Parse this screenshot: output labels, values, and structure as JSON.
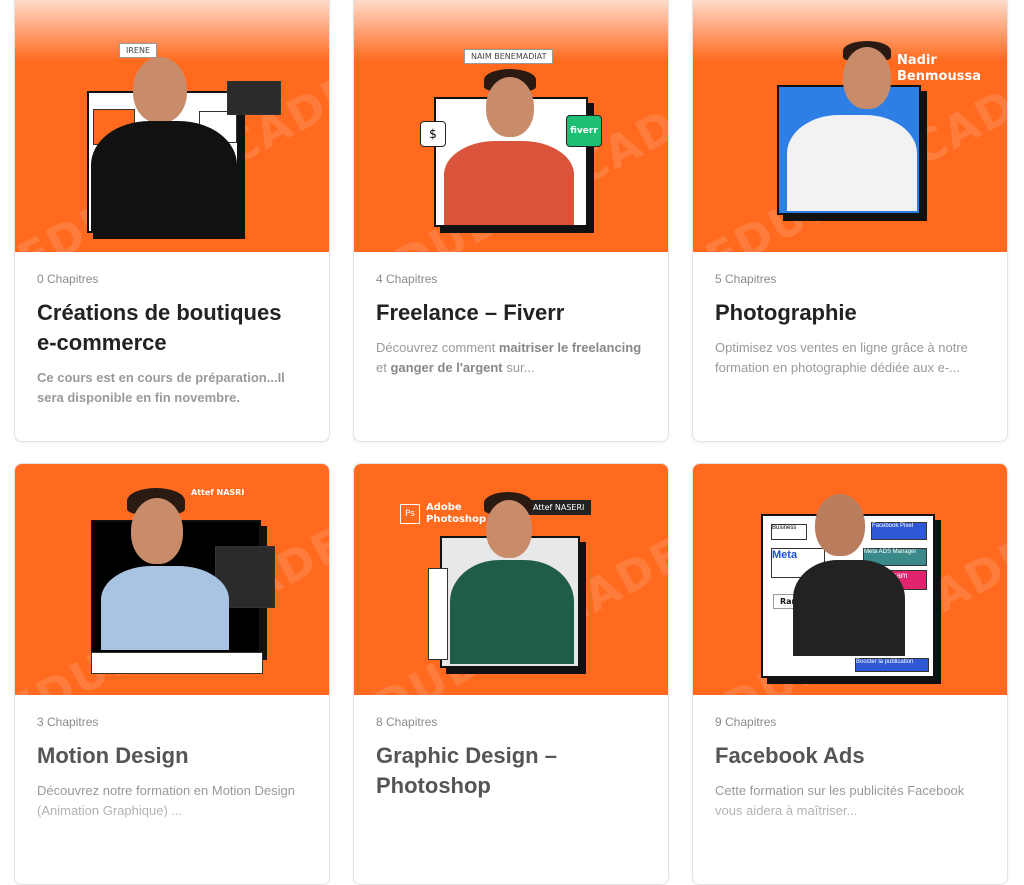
{
  "courses": [
    {
      "chapters": "0 Chapitres",
      "title": "Créations de boutiques e-commerce",
      "desc_parts": [
        "Ce cours est en cours de préparation...Il sera disponible en fin novembre."
      ],
      "instructor_tag": "IRENE"
    },
    {
      "chapters": "4 Chapitres",
      "title": "Freelance – Fiverr",
      "desc_1": "Découvrez comment ",
      "desc_2": "maitriser le freelancing",
      "desc_3": " et ",
      "desc_4": "ganger de l'argent",
      "desc_5": " sur...",
      "instructor_tag": "NAIM BENEMADIAT",
      "badge": "fiverr"
    },
    {
      "chapters": "5 Chapitres",
      "title": "Photographie",
      "desc": "Optimisez vos ventes en ligne grâce à notre formation en photographie dédiée aux e-...",
      "instructor_name_1": "Nadir",
      "instructor_name_2": "Benmoussa"
    },
    {
      "chapters": "3 Chapitres",
      "title": "Motion Design",
      "desc": "Découvrez notre formation en Motion Design (Animation Graphique) ...",
      "instructor_tag": "Attef NASRI"
    },
    {
      "chapters": "8 Chapitres",
      "title": "Graphic Design – Photoshop",
      "desc": "",
      "app_label_1": "Adobe",
      "app_label_2": "Photoshop",
      "app_icon": "Ps",
      "instructor_tag": "Attef NASERI"
    },
    {
      "chapters": "9 Chapitres",
      "title": "Facebook Ads",
      "desc": "Cette formation sur les publicités Facebook vous aidera à maîtriser...",
      "instructor_tag": "Ramzi IKOUIRENE",
      "ui_labels": [
        "Business",
        "Facebook Pixel",
        "Meta",
        "Meta ADS Manager",
        "Instagram",
        "Booster la publication"
      ]
    }
  ],
  "colors": {
    "accent": "#ff6a1f",
    "title": "#222222",
    "muted": "#999999"
  }
}
